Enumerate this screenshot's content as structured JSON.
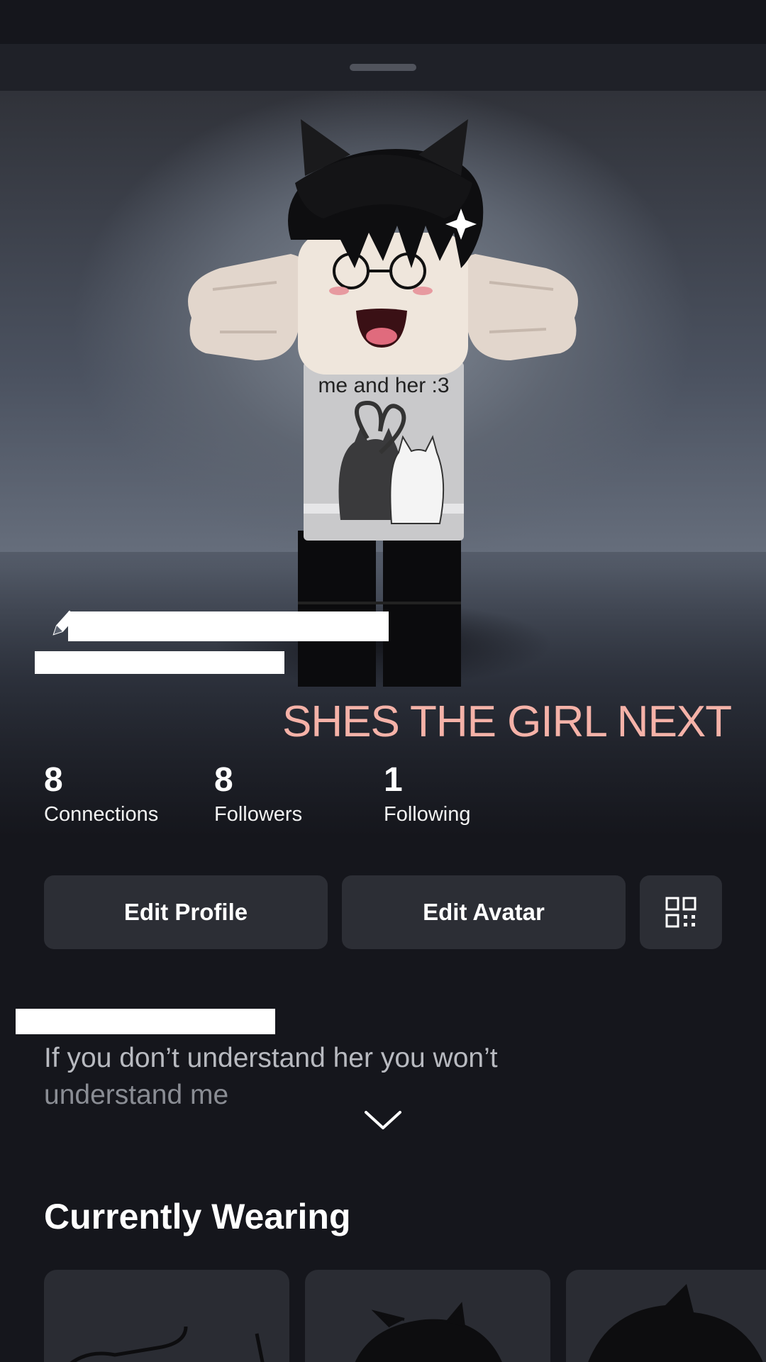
{
  "profile": {
    "status_banner": "SHES THE GIRL NEXT",
    "shirt_text": "me and her :3"
  },
  "stats": [
    {
      "value": "8",
      "label": "Connections"
    },
    {
      "value": "8",
      "label": "Followers"
    },
    {
      "value": "1",
      "label": "Following"
    }
  ],
  "actions": {
    "edit_profile": "Edit Profile",
    "edit_avatar": "Edit Avatar"
  },
  "about": {
    "line1": "If you don’t understand her you won’t",
    "line2": "understand me"
  },
  "currently_wearing": {
    "title": "Currently Wearing"
  },
  "icons": {
    "qr": "qr-code-icon",
    "expand": "chevron-down-icon",
    "edit": "pencil-icon"
  },
  "colors": {
    "background": "#15161c",
    "button": "#2c2e35",
    "banner_text": "#f5b2a8"
  }
}
